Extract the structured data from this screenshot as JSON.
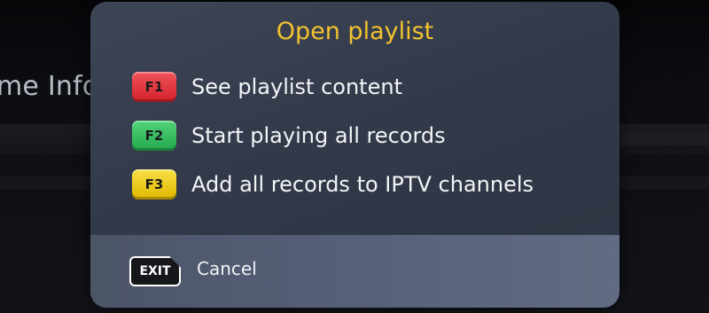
{
  "background": {
    "partial_text": "me Infor"
  },
  "dialog": {
    "title": "Open playlist",
    "options": [
      {
        "key": "F1",
        "key_color": "#dd2e37",
        "label": "See playlist content"
      },
      {
        "key": "F2",
        "key_color": "#2cb85a",
        "label": "Start playing all records"
      },
      {
        "key": "F3",
        "key_color": "#ecc515",
        "label": "Add all records to IPTV channels"
      }
    ],
    "footer": {
      "exit_key": "EXIT",
      "cancel_label": "Cancel"
    }
  },
  "colors": {
    "title": "#f2c230",
    "dialog_bg": "#363e4f",
    "footer_bg": "#57607a"
  }
}
